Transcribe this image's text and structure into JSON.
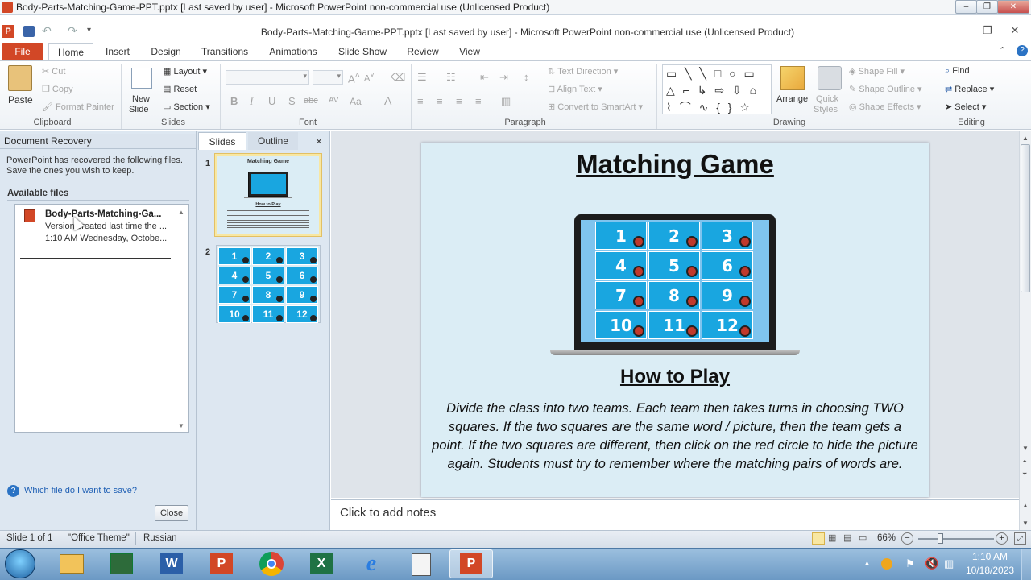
{
  "outer_title": "Body-Parts-Matching-Game-PPT.pptx [Last saved by user] - Microsoft PowerPoint non-commercial use (Unlicensed Product)",
  "inner_title": "Body-Parts-Matching-Game-PPT.pptx [Last saved by user]  -  Microsoft PowerPoint non-commercial use (Unlicensed Product)",
  "tabs": [
    "File",
    "Home",
    "Insert",
    "Design",
    "Transitions",
    "Animations",
    "Slide Show",
    "Review",
    "View"
  ],
  "ribbon": {
    "clipboard": {
      "paste": "Paste",
      "cut": "Cut",
      "copy": "Copy",
      "format_painter": "Format Painter",
      "label": "Clipboard"
    },
    "slides": {
      "new_slide": "New",
      "new_slide2": "Slide",
      "layout": "Layout",
      "reset": "Reset",
      "section": "Section",
      "label": "Slides"
    },
    "font": {
      "label": "Font",
      "bold": "B",
      "italic": "I",
      "underline": "U",
      "shadow": "S",
      "strike": "abc",
      "spacing": "AV",
      "case": "Aa",
      "color": "A"
    },
    "paragraph": {
      "text_direction": "Text Direction",
      "align_text": "Align Text",
      "convert_smartart": "Convert to SmartArt",
      "label": "Paragraph"
    },
    "drawing": {
      "arrange": "Arrange",
      "quick_styles": "Quick",
      "quick_styles2": "Styles",
      "shape_fill": "Shape Fill",
      "shape_outline": "Shape Outline",
      "shape_effects": "Shape Effects",
      "label": "Drawing"
    },
    "editing": {
      "find": "Find",
      "replace": "Replace",
      "select": "Select",
      "label": "Editing"
    }
  },
  "recovery": {
    "title": "Document Recovery",
    "message_line1": "PowerPoint has recovered the following files.",
    "message_line2": "Save the ones you wish to keep.",
    "available": "Available files",
    "file_name": "Body-Parts-Matching-Ga...",
    "file_version": "Version created last time the ...",
    "file_time": "1:10 AM Wednesday, Octobe...",
    "help_link": "Which file do I want to save?",
    "close": "Close"
  },
  "slides_pane": {
    "tab_slides": "Slides",
    "tab_outline": "Outline",
    "close": "×",
    "slide1_num": "1",
    "slide2_num": "2",
    "thumb_title": "Matching Game",
    "thumb_subtitle": "How to Play"
  },
  "slide": {
    "title": "Matching Game",
    "subtitle": "How to Play",
    "body": "Divide the class into two teams. Each team then takes turns in choosing TWO squares. If the two squares are the same word / picture, then the team gets a point. If the two squares are different, then click on the red circle to hide the picture again. Students must try to remember where the matching pairs of words are.",
    "cells": [
      "1",
      "2",
      "3",
      "4",
      "5",
      "6",
      "7",
      "8",
      "9",
      "10",
      "11",
      "12"
    ]
  },
  "notes_placeholder": "Click to add notes",
  "status": {
    "slide": "Slide 1 of 1",
    "theme": "\"Office Theme\"",
    "language": "Russian",
    "zoom": "66%"
  },
  "clock": {
    "time": "1:10 AM",
    "date": "10/18/2023"
  },
  "colors": {
    "file_tab": "#d24726",
    "cell": "#19a6e0",
    "slide_bg": "#dbedf5",
    "taskbar": "#6b99c4"
  }
}
